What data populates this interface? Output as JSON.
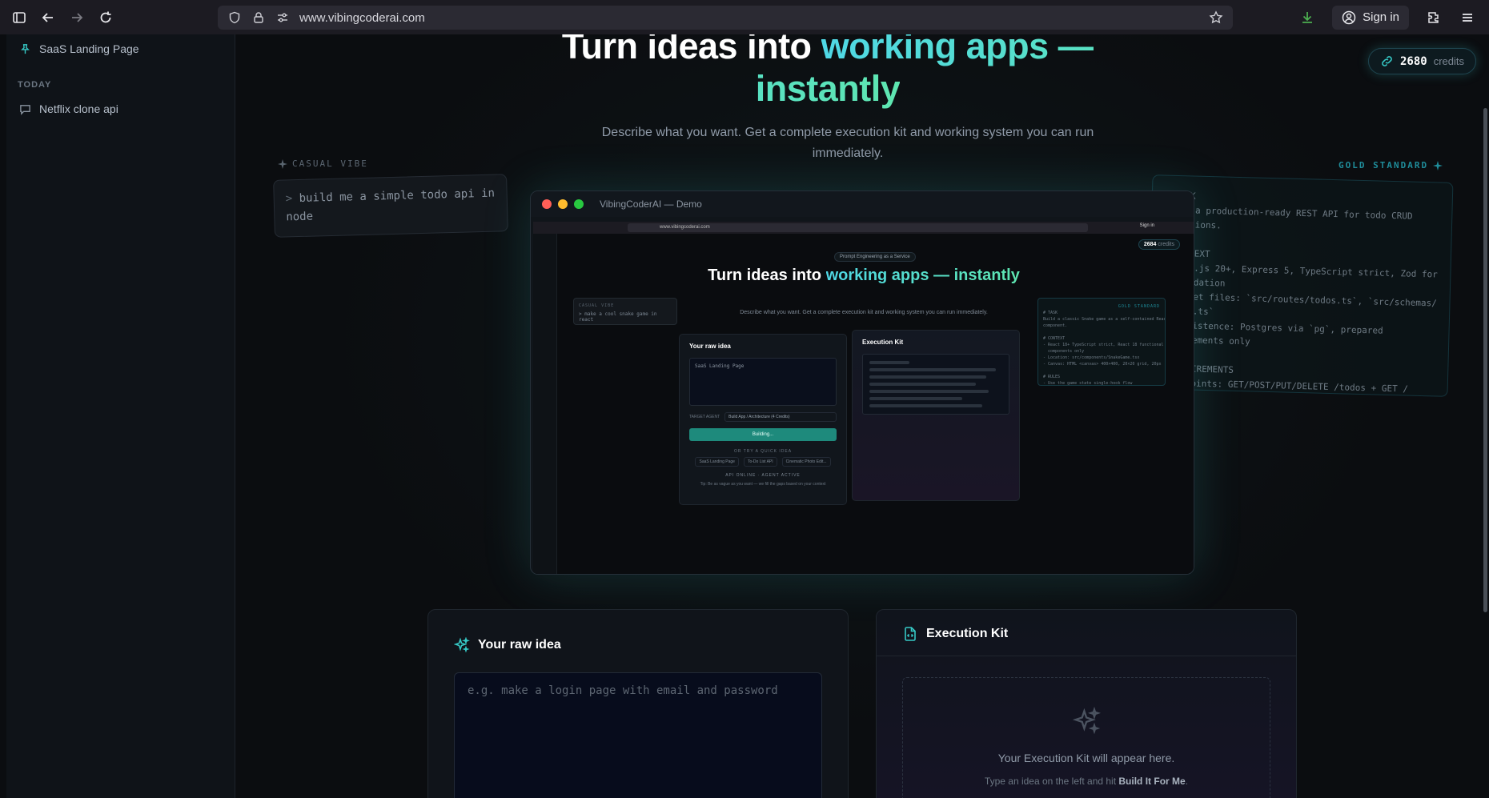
{
  "browser": {
    "url": "www.vibingcoderai.com",
    "signin_label": "Sign in"
  },
  "sidebar": {
    "pinned": {
      "label": "SaaS Landing Page",
      "icon": "pin-icon"
    },
    "section_today": "TODAY",
    "chats": [
      {
        "label": "Netflix clone api",
        "icon": "chat-icon"
      }
    ]
  },
  "header": {
    "credits_value": "2680",
    "credits_label": "credits"
  },
  "hero": {
    "title_plain": "Turn ideas into ",
    "title_accent": "working apps — instantly",
    "subtitle": "Describe what you want. Get a complete execution kit and working system you can run immediately."
  },
  "examples": {
    "casual_label": "CASUAL VIBE",
    "casual_prompt_marker": ">",
    "casual_prompt": "build me a simple todo api in node",
    "gold_label": "GOLD STANDARD",
    "gold_text": "# TASK\nBuild a production-ready REST API for todo CRUD\noperations.\n\n# CONTEXT\n- Node.js 20+, Express 5, TypeScript strict, Zod for\n  validation\n- Target files: `src/routes/todos.ts`, `src/schemas/\n  todo.ts`\n- Persistence: Postgres via `pg`, prepared\n  statements only\n\n# REQUIREMENTS\n- Endpoints: GET/POST/PUT/DELETE /todos + GET /"
  },
  "demo": {
    "window_title": "VibingCoderAI — Demo",
    "mini_url": "www.vibingcoderai.com",
    "mini_signin": "Sign in",
    "mini_badge": "Prompt Engineering as a Service",
    "mini_credits_value": "2684",
    "mini_credits_label": "credits",
    "mini_title_plain": "Turn ideas into ",
    "mini_title_accent": "working apps — instantly",
    "mini_subtitle": "Describe what you want. Get a complete execution kit and working system you can run immediately.",
    "mini_casual_label": "CASUAL VIBE",
    "mini_casual_prompt": "> make a cool snake game in react",
    "mini_gold_label": "GOLD STANDARD",
    "mini_gold_text": "# TASK\nBuild a classic Snake game as a self-contained React\ncomponent.\n\n# CONTEXT\n- React 18+ TypeScript strict, React 18 functional\n  components only\n- Location: src/components/SnakeGame.tsx\n- Canvas: HTML <canvas> 400×400, 20×20 grid, 20px\n\n# RULES\n- Use the game state single-hook flow",
    "mini_raw_title": "Your raw idea",
    "mini_raw_value": "SaaS Landing Page",
    "mini_target_label": "TARGET AGENT",
    "mini_target_value": "Build App / Architecture (4 Credits)",
    "mini_build_button": "Building...",
    "mini_quick_label": "OR TRY A QUICK IDEA",
    "mini_quick_ideas": [
      "SaaS Landing Page",
      "To-Do List API",
      "Cinematic Photo Edit..."
    ],
    "mini_status": "API ONLINE · AGENT ACTIVE",
    "mini_tip": "Tip: Be as vague as you want — we fill the gaps based on your context",
    "mini_kit_title": "Execution Kit"
  },
  "raw_idea_card": {
    "title": "Your raw idea",
    "placeholder": "e.g. make a login page with email and password"
  },
  "kit_card": {
    "title": "Execution Kit",
    "empty_text": "Your Execution Kit will appear here.",
    "hint_prefix": "Type an idea on the left and hit ",
    "hint_action": "Build It For Me",
    "hint_suffix": "."
  },
  "colors": {
    "accent": "#36c9c6",
    "accent_green": "#5ee6b0",
    "background": "#0b0d10"
  }
}
